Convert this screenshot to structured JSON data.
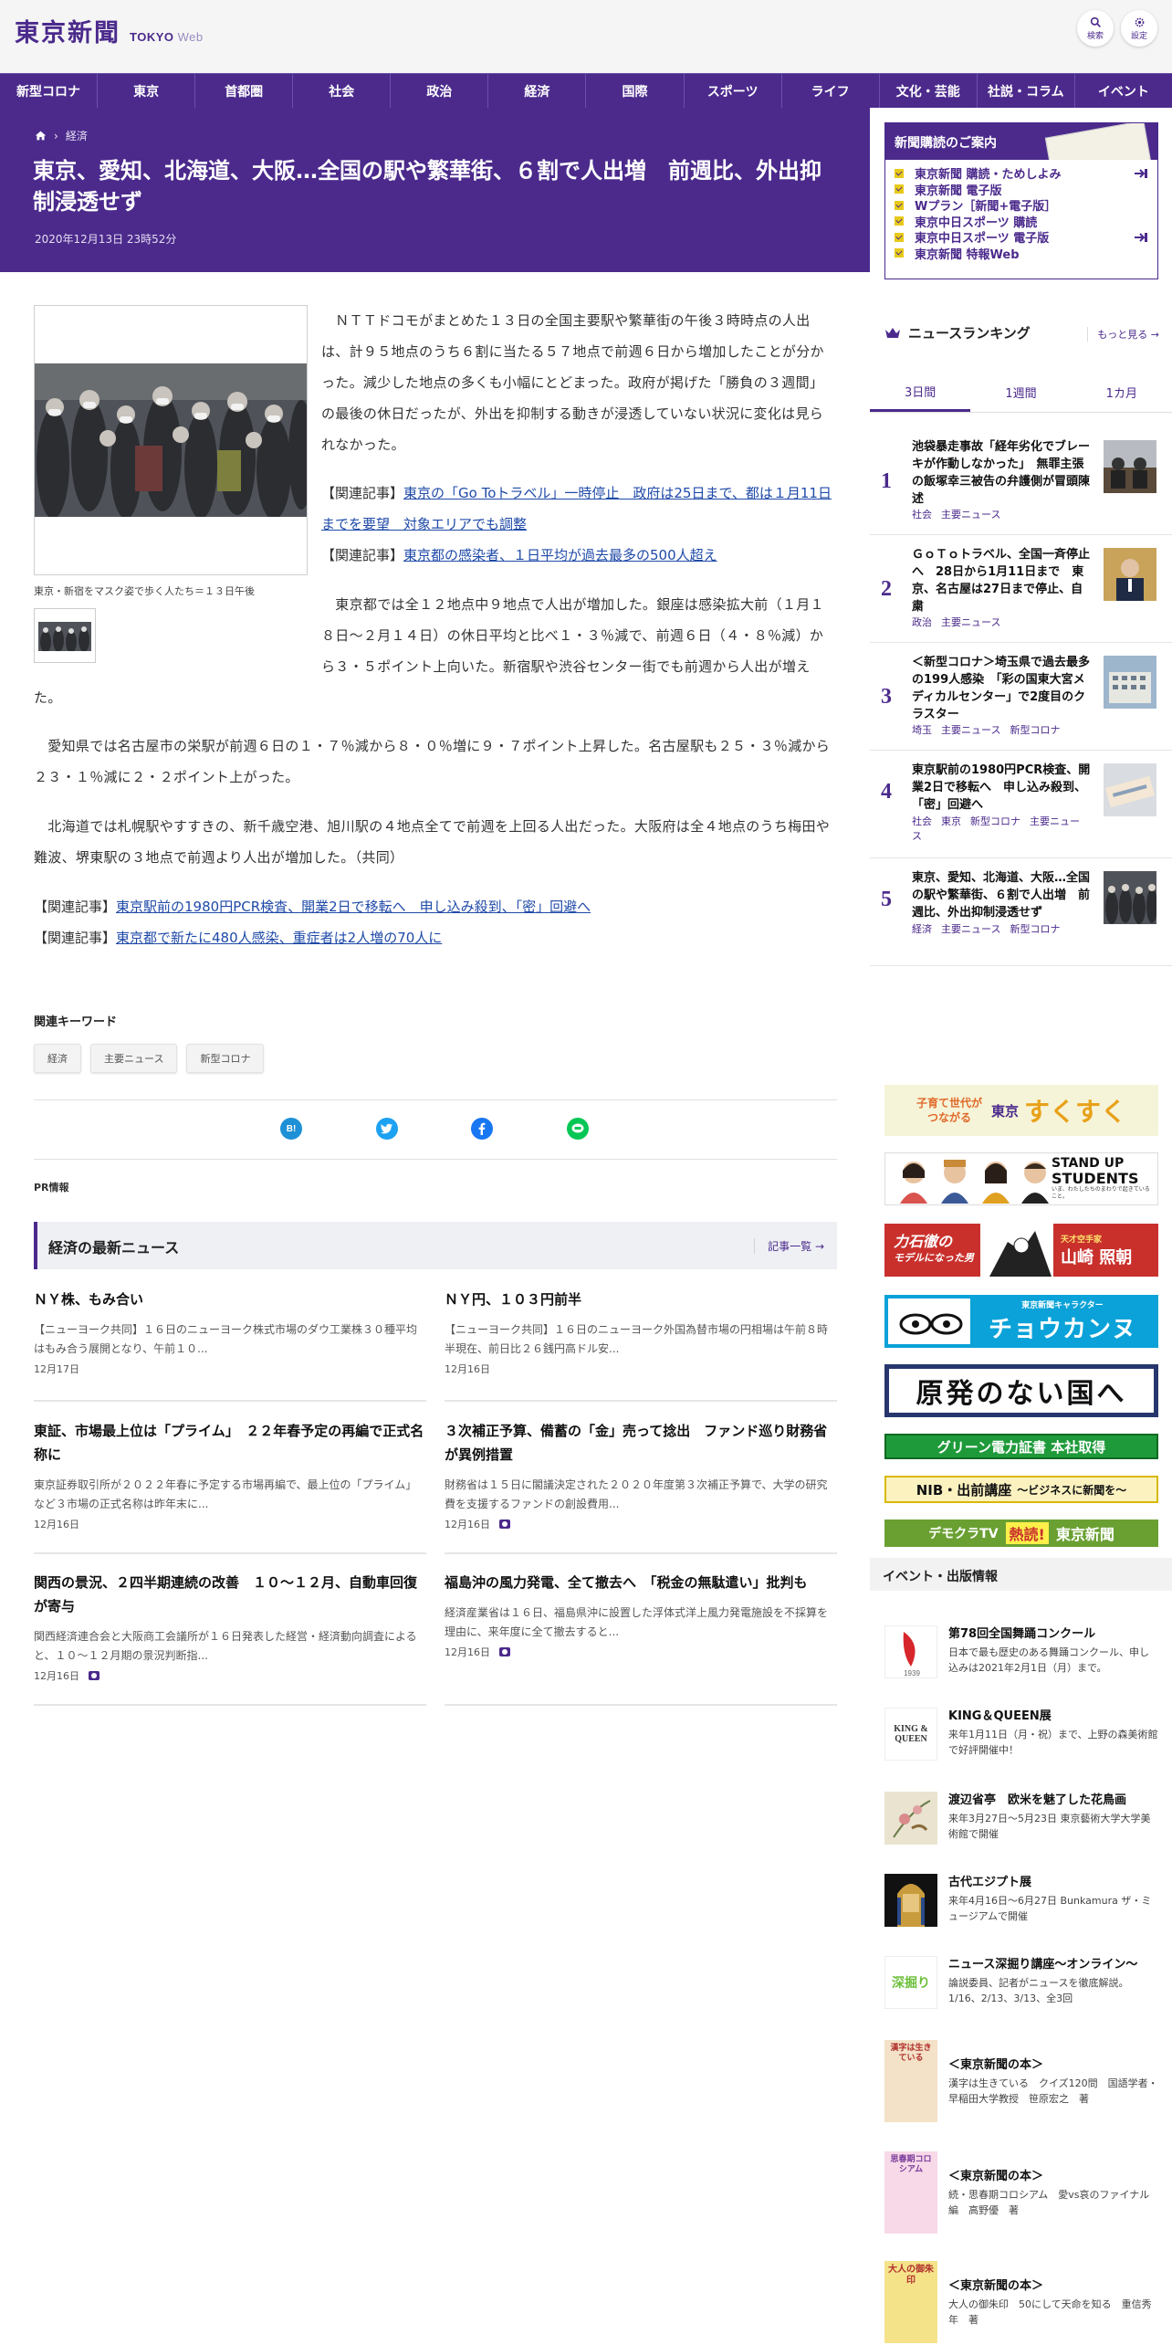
{
  "header": {
    "logo_jp": "東京新聞",
    "logo_en": "TOKYO",
    "logo_web": "Web",
    "search_label": "検索",
    "settings_label": "設定"
  },
  "nav": [
    "新型コロナ",
    "東京",
    "首都圏",
    "社会",
    "政治",
    "経済",
    "国際",
    "スポーツ",
    "ライフ",
    "文化・芸能",
    "社説・コラム",
    "イベント"
  ],
  "breadcrumb": {
    "section": "経済"
  },
  "article": {
    "title": "東京、愛知、北海道、大阪…全国の駅や繁華街、６割で人出増　前週比、外出抑制浸透せず",
    "date": "2020年12月13日 23時52分",
    "caption": "東京・新宿をマスク姿で歩く人たち＝１３日午後",
    "p1": "　ＮＴＴドコモがまとめた１３日の全国主要駅や繁華街の午後３時時点の人出は、計９５地点のうち６割に当たる５７地点で前週６日から増加したことが分かった。減少した地点の多くも小幅にとどまった。政府が掲げた「勝負の３週間」の最後の休日だったが、外出を抑制する動きが浸透していない状況に変化は見られなかった。",
    "rel_label": "【関連記事】",
    "rel1": "東京の「Go Toトラベル」一時停止　政府は25日まで、都は１月11日までを要望　対象エリアでも調整",
    "rel2": "東京都の感染者、１日平均が過去最多の500人超え",
    "p2": "　東京都では全１２地点中９地点で人出が増加した。銀座は感染拡大前（１月１８日～２月１４日）の休日平均と比べ１・３％減で、前週６日（４・８％減）から３・５ポイント上向いた。新宿駅や渋谷センター街でも前週から人出が増えた。",
    "p3": "　愛知県では名古屋市の栄駅が前週６日の１・７％減から８・０％増に９・７ポイント上昇した。名古屋駅も２５・３％減から２３・１％減に２・２ポイント上がった。",
    "p4": "　北海道では札幌駅やすすきの、新千歳空港、旭川駅の４地点全てで前週を上回る人出だった。大阪府は全４地点のうち梅田や難波、堺東駅の３地点で前週より人出が増加した。（共同）",
    "rel3": "東京駅前の1980円PCR検査、開業2日で移転へ　申し込み殺到、「密」回避へ",
    "rel4": "東京都で新たに480人感染、重症者は2人増の70人に"
  },
  "keywords": {
    "title": "関連キーワード",
    "items": [
      "経済",
      "主要ニュース",
      "新型コロナ"
    ]
  },
  "share": {
    "hatena": "B!"
  },
  "pr_label": "PR情報",
  "econ_news": {
    "title": "経済の最新ニュース",
    "more": "記事一覧",
    "items": [
      {
        "title": "ＮＹ株、もみ合い",
        "text": "【ニューヨーク共同】１６日のニューヨーク株式市場のダウ工業株３０種平均はもみ合う展開となり、午前１０...",
        "date": "12月17日"
      },
      {
        "title": "ＮＹ円、１０３円前半",
        "text": "【ニューヨーク共同】１６日のニューヨーク外国為替市場の円相場は午前８時半現在、前日比２６銭円高ドル安...",
        "date": "12月16日"
      },
      {
        "title": "東証、市場最上位は「プライム」　２２年春予定の再編で正式名称に",
        "text": "東京証券取引所が２０２２年春に予定する市場再編で、最上位の「プライム」など３市場の正式名称は昨年末に...",
        "date": "12月16日"
      },
      {
        "title": "３次補正予算、備蓄の「金」売って捻出　ファンド巡り財務省が異例措置",
        "text": "財務省は１５日に閣議決定された２０２０年度第３次補正予算で、大学の研究費を支援するファンドの創設費用...",
        "date": "12月16日"
      },
      {
        "title": "関西の景況、２四半期連続の改善　１０～１２月、自動車回復が寄与",
        "text": "関西経済連合会と大阪商工会議所が１６日発表した経営・経済動向調査によると、１０～１２月期の景況判断指...",
        "date": "12月16日"
      },
      {
        "title": "福島沖の風力発電、全て撤去へ　「税金の無駄遣い」批判も",
        "text": "経済産業省は１６日、福島県沖に設置した浮体式洋上風力発電施設を不採算を理由に、来年度に全て撤去すると...",
        "date": "12月16日"
      }
    ]
  },
  "subscribe": {
    "title": "新聞購読のご案内",
    "items": [
      "東京新聞 購読・ためしよみ",
      "東京新聞 電子版",
      "Wプラン［新聞+電子版］",
      "東京中日スポーツ 購読",
      "東京中日スポーツ 電子版",
      "東京新聞 特報Web"
    ]
  },
  "ranking": {
    "title": "ニュースランキング",
    "more": "もっと見る",
    "tabs": [
      "3日間",
      "1週間",
      "1カ月"
    ],
    "items": [
      {
        "num": "1",
        "title": "池袋暴走事故「経年劣化でブレーキが作動しなかった」　無罪主張の飯塚幸三被告の弁護側が冒頭陳述",
        "tags": [
          "社会",
          "主要ニュース"
        ]
      },
      {
        "num": "2",
        "title": "ＧｏＴｏトラベル、全国一斉停止へ　28日から1月11日まで　東京、名古屋は27日まで停止、自粛",
        "tags": [
          "政治",
          "主要ニュース"
        ]
      },
      {
        "num": "3",
        "title": "＜新型コロナ＞埼玉県で過去最多の199人感染　「彩の国東大宮メディカルセンター」で2度目のクラスター",
        "tags": [
          "埼玉",
          "主要ニュース",
          "新型コロナ"
        ]
      },
      {
        "num": "4",
        "title": "東京駅前の1980円PCR検査、開業2日で移転へ　申し込み殺到、「密」回避へ",
        "tags": [
          "社会",
          "東京",
          "新型コロナ",
          "主要ニュース"
        ]
      },
      {
        "num": "5",
        "title": "東京、愛知、北海道、大阪…全国の駅や繁華街、６割で人出増　前週比、外出抑制浸透せず",
        "tags": [
          "経済",
          "主要ニュース",
          "新型コロナ"
        ]
      }
    ]
  },
  "banners": {
    "sukusuku_a": "子育て世代が",
    "sukusuku_b": "つながる",
    "sukusuku_c": "東京",
    "sukusuku_d": "すくすく",
    "students_a": "STAND UP",
    "students_b": "STUDENTS",
    "students_c": "いま、わたしたちのまわりで起きていること。",
    "rikishi_a": "力石徹の",
    "rikishi_b": "モデルになった男",
    "rikishi_c": "天才空手家",
    "rikishi_d": "山崎 照朝",
    "chokanu_a": "東京新聞キャラクター",
    "chokanu_b": "チョウカンヌ",
    "genpatsu": "原発のない国へ",
    "green": "グリーン電力証書 本社取得",
    "nib_a": "NIB・出前講座",
    "nib_b": "～ビジネスに新聞を～",
    "democra_a": "デモクラTV",
    "democra_b": "熱読!",
    "democra_c": "東京新聞"
  },
  "events": {
    "title": "イベント・出版情報",
    "items": [
      {
        "title": "第78回全国舞踊コンクール",
        "desc": "日本で最も歴史のある舞踊コンクール、申し込みは2021年2月1日（月）まで。",
        "thumb_text": "1939"
      },
      {
        "title": "KING＆QUEEN展",
        "desc": "来年1月11日（月・祝）まで、上野の森美術館で好評開催中！",
        "thumb_text": "KING & QUEEN"
      },
      {
        "title": "渡辺省亭　欧米を魅了した花鳥画",
        "desc": "来年3月27日～5月23日 東京藝術大学大学美術館で開催",
        "thumb_text": ""
      },
      {
        "title": "古代エジプト展",
        "desc": "来年4月16日～6月27日 Bunkamura ザ・ミュージアムで開催",
        "thumb_text": ""
      },
      {
        "title": "ニュース深掘り講座～オンライン～",
        "desc": "論説委員、記者がニュースを徹底解説。1/16、2/13、3/13、全3回",
        "thumb_text": "深掘り"
      },
      {
        "title": "＜東京新聞の本＞",
        "desc": "漢字は生きている　クイズ120問　国語学者・早稲田大学教授　笹原宏之　著",
        "thumb_text": "漢字は生きている"
      },
      {
        "title": "＜東京新聞の本＞",
        "desc": "続・思春期コロシアム　愛vs哀のファイナル編　高野優　著",
        "thumb_text": "思春期コロシアム"
      },
      {
        "title": "＜東京新聞の本＞",
        "desc": "大人の御朱印　50にして天命を知る　重信秀年　著",
        "thumb_text": "大人の御朱印"
      }
    ]
  },
  "colors": {
    "brand": "#4b2a8c",
    "link": "#1f4aa8",
    "yellow": "#e8c91a"
  }
}
